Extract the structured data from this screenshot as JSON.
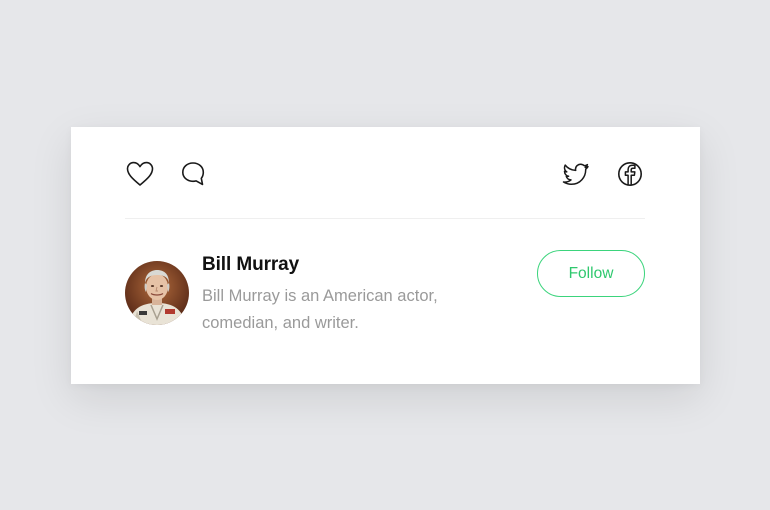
{
  "actions": {
    "left": [
      {
        "icon": "heart-icon"
      },
      {
        "icon": "comment-icon"
      }
    ],
    "right": [
      {
        "icon": "twitter-icon"
      },
      {
        "icon": "facebook-icon"
      }
    ]
  },
  "profile": {
    "name": "Bill Murray",
    "bio": "Bill Murray is an American actor, comedian, and writer.",
    "follow_label": "Follow",
    "accent_color": "#3bd47c"
  }
}
